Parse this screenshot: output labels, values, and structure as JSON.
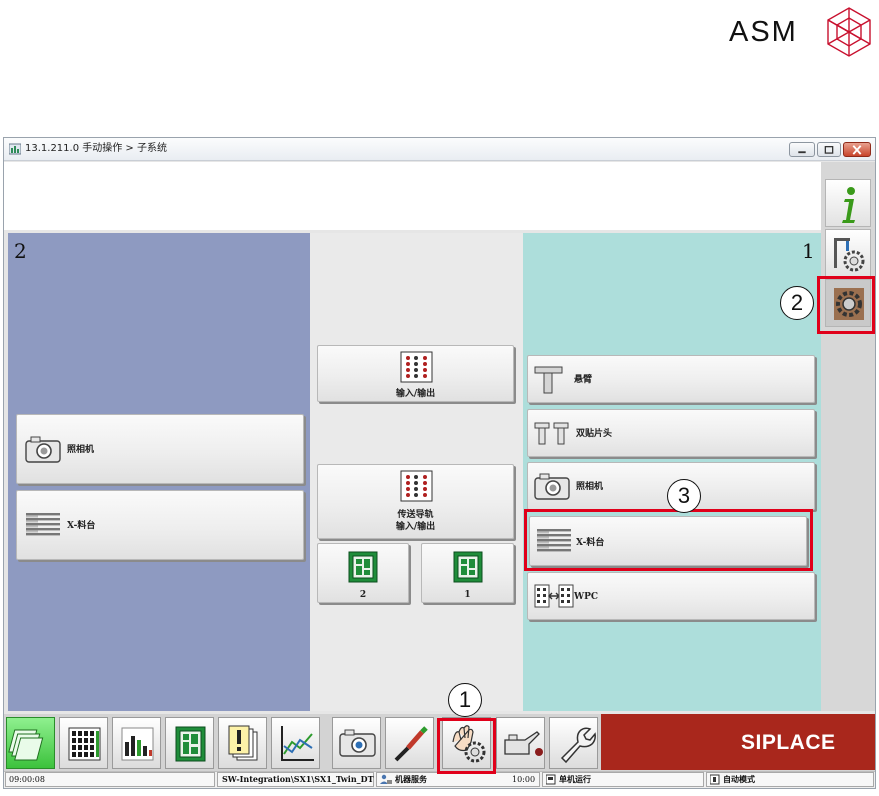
{
  "brand": {
    "logo_text": "ASM",
    "siplace_text": "SIPLACE",
    "siplace_color": "#a9271c"
  },
  "window": {
    "title": "13.1.211.0 手动操作 > 子系统"
  },
  "colors": {
    "left_panel": "#8e9ac1",
    "right_panel": "#addedb",
    "highlight_red": "#e0001a"
  },
  "panels": {
    "left": {
      "number": "2",
      "buttons": [
        {
          "label": "照相机",
          "icon": "camera-icon"
        },
        {
          "label": "X-料台",
          "icon": "feeder-table-icon"
        }
      ]
    },
    "center": {
      "io_label": "输入/输出",
      "conveyor_label_line1": "传送导轨",
      "conveyor_label_line2": "输入/输出",
      "lane_buttons": [
        {
          "label": "2",
          "icon": "pcb-icon"
        },
        {
          "label": "1",
          "icon": "pcb-icon"
        }
      ]
    },
    "right": {
      "number": "1",
      "buttons": [
        {
          "label": "悬臂",
          "icon": "gantry-icon"
        },
        {
          "label": "双贴片头",
          "icon": "twin-head-icon"
        },
        {
          "label": "照相机",
          "icon": "camera-icon"
        },
        {
          "label": "X-料台",
          "icon": "feeder-table-icon"
        },
        {
          "label": "WPC",
          "icon": "wpc-icon"
        }
      ]
    }
  },
  "side_toolbar": [
    {
      "icon": "info-icon"
    },
    {
      "icon": "machine-settings-icon"
    },
    {
      "icon": "subsystem-gear-icon"
    }
  ],
  "bottom_toolbar": [
    {
      "icon": "production-icon",
      "active": true
    },
    {
      "icon": "component-grid-icon"
    },
    {
      "icon": "statistics-icon"
    },
    {
      "icon": "pcb-icon"
    },
    {
      "icon": "warnings-icon"
    },
    {
      "icon": "line-chart-icon"
    },
    {
      "icon": "camera-icon"
    },
    {
      "icon": "tools-icon"
    },
    {
      "icon": "manual-operation-icon"
    },
    {
      "icon": "oil-can-icon"
    },
    {
      "icon": "wrench-icon"
    }
  ],
  "callouts": [
    "1",
    "2",
    "3"
  ],
  "status_bar": {
    "time": "09:00:08",
    "station": "SW-Integration\\SX1\\SX1_Twin_DT",
    "user_mode": "机器服务",
    "clock": "10:00",
    "run_mode": "单机运行",
    "auto_mode": "自动模式"
  }
}
